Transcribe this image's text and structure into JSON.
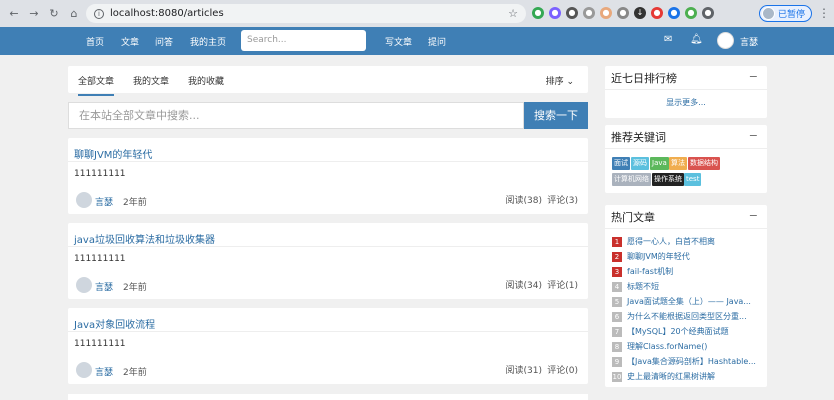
{
  "browser": {
    "url": "localhost:8080/articles",
    "pause_label": "已暂停"
  },
  "navbar": {
    "links": [
      "首页",
      "文章",
      "问答",
      "我的主页"
    ],
    "search_placeholder": "Search...",
    "write_label": "写文章",
    "ask_label": "提问",
    "username": "言瑟"
  },
  "tabs": {
    "items": [
      "全部文章",
      "我的文章",
      "我的收藏"
    ],
    "sort_label": "排序 ⌄"
  },
  "site_search": {
    "placeholder": "在本站全部文章中搜索...",
    "button": "搜索一下"
  },
  "articles": [
    {
      "title": "聊聊JVM的年轻代",
      "summary": "111111111",
      "author": "言瑟",
      "time": "2年前",
      "reads": "阅读(38)",
      "comments": "评论(3)"
    },
    {
      "title": "java垃圾回收算法和垃圾收集器",
      "summary": "111111111",
      "author": "言瑟",
      "time": "2年前",
      "reads": "阅读(34)",
      "comments": "评论(1)"
    },
    {
      "title": "Java对象回收流程",
      "summary": "111111111",
      "author": "言瑟",
      "time": "2年前",
      "reads": "阅读(31)",
      "comments": "评论(0)"
    }
  ],
  "sidebar": {
    "ranking": {
      "title": "近七日排行榜",
      "collapse": "−",
      "more": "显示更多..."
    },
    "keywords": {
      "title": "推荐关键词",
      "collapse": "−",
      "items": [
        {
          "label": "面试",
          "color": "#3f7fb5"
        },
        {
          "label": "源码",
          "color": "#5bc0de"
        },
        {
          "label": "Java",
          "color": "#5cb85c"
        },
        {
          "label": "算法",
          "color": "#f0ad4e"
        },
        {
          "label": "数据结构",
          "color": "#d9534f"
        },
        {
          "label": "计算机网络",
          "color": "#aab2bd"
        },
        {
          "label": "操作系统",
          "color": "#222222"
        },
        {
          "label": "test",
          "color": "#5bc0de"
        }
      ]
    },
    "hot": {
      "title": "热门文章",
      "collapse": "−",
      "items": [
        {
          "num": "1",
          "text": "愿得一心人，白首不相离",
          "color": "#c9302c"
        },
        {
          "num": "2",
          "text": "聊聊JVM的年轻代",
          "color": "#c9302c"
        },
        {
          "num": "3",
          "text": "fail-fast机制",
          "color": "#c9302c"
        },
        {
          "num": "4",
          "text": "标题不短",
          "color": "#bbbbbb"
        },
        {
          "num": "5",
          "text": "Java面试题全集（上）—— Java...",
          "color": "#bbbbbb"
        },
        {
          "num": "6",
          "text": "为什么不能根据返回类型区分重...",
          "color": "#bbbbbb"
        },
        {
          "num": "7",
          "text": "【MySQL】20个经典面试题",
          "color": "#bbbbbb"
        },
        {
          "num": "8",
          "text": "理解Class.forName()",
          "color": "#bbbbbb"
        },
        {
          "num": "9",
          "text": "【Java集合源码剖析】Hashtable...",
          "color": "#bbbbbb"
        },
        {
          "num": "10",
          "text": "史上最清晰的红黑树讲解",
          "color": "#bbbbbb"
        }
      ]
    }
  }
}
